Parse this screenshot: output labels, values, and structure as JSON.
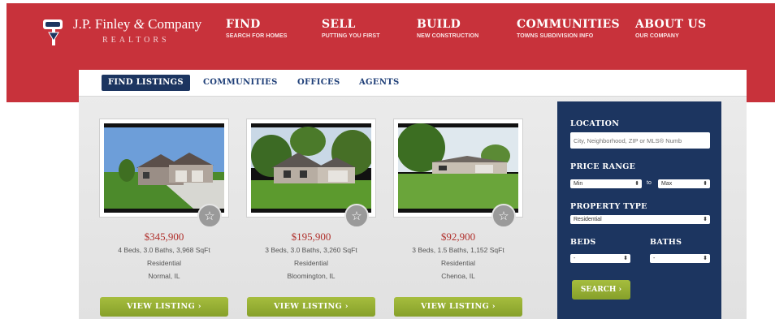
{
  "logo": {
    "name": "J.P. Finley",
    "connector": "&",
    "company": "Company",
    "tagline": "REALTORS"
  },
  "nav": [
    {
      "label": "FIND",
      "sub": "SEARCH FOR HOMES"
    },
    {
      "label": "SELL",
      "sub": "PUTTING YOU FIRST"
    },
    {
      "label": "BUILD",
      "sub": "NEW CONSTRUCTION"
    },
    {
      "label": "COMMUNITIES",
      "sub": "TOWNS SUBDIVISION INFO"
    },
    {
      "label": "ABOUT US",
      "sub": "OUR COMPANY"
    }
  ],
  "tabs": [
    "FIND LISTINGS",
    "COMMUNITIES",
    "OFFICES",
    "AGENTS"
  ],
  "listings": [
    {
      "price": "$345,900",
      "details": "4 Beds, 3.0 Baths, 3,968 SqFt",
      "type": "Residential",
      "location": "Normal, IL",
      "button": "VIEW LISTING ›"
    },
    {
      "price": "$195,900",
      "details": "3 Beds, 3.0 Baths, 3,260 SqFt",
      "type": "Residential",
      "location": "Bloomington, IL",
      "button": "VIEW LISTING ›"
    },
    {
      "price": "$92,900",
      "details": "3 Beds, 1.5 Baths, 1,152 SqFt",
      "type": "Residential",
      "location": "Chenoa, IL",
      "button": "VIEW LISTING ›"
    }
  ],
  "search": {
    "location_label": "LOCATION",
    "location_placeholder": "City, Neighborhood, ZIP or MLS® Numb",
    "price_label": "PRICE RANGE",
    "min": "Min",
    "to": "to",
    "max": "Max",
    "property_label": "PROPERTY TYPE",
    "property_value": "Residential",
    "beds_label": "BEDS",
    "baths_label": "BATHS",
    "beds_value": "-",
    "baths_value": "-",
    "button": "SEARCH ›"
  },
  "icons": {
    "favorite": "star-icon",
    "dropdown": "chevron-down-icon",
    "logo": "sign-badge-icon"
  },
  "colors": {
    "header": "#c8323b",
    "navy": "#1c3560",
    "green": "#94ad33",
    "price": "#b0302c"
  }
}
